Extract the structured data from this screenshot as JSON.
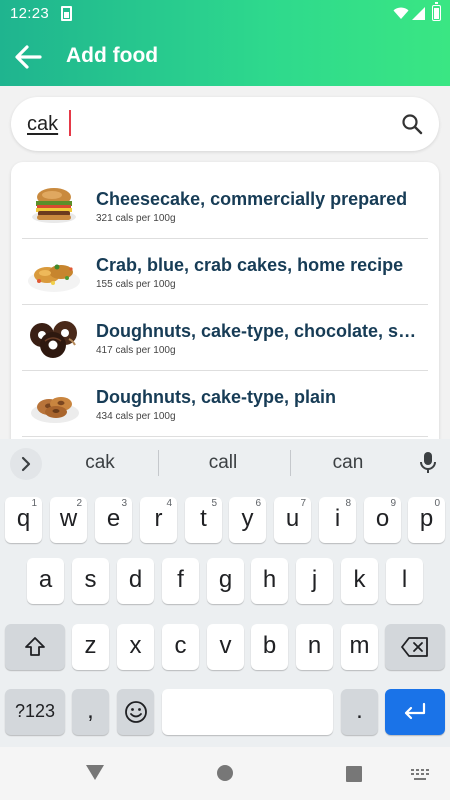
{
  "status_bar": {
    "time": "12:23"
  },
  "app_bar": {
    "title": "Add food"
  },
  "search": {
    "value": "cak"
  },
  "results": [
    {
      "name": "Cheesecake, commercially prepared",
      "cals": "321 cals per 100g",
      "image": "cheesecake"
    },
    {
      "name": "Crab, blue, crab cakes, home recipe",
      "cals": "155 cals per 100g",
      "image": "crab-cakes"
    },
    {
      "name": "Doughnuts, cake-type, chocolate, sugared or glazed",
      "cals": "417 cals per 100g",
      "image": "chocolate-doughnuts"
    },
    {
      "name": "Doughnuts, cake-type, plain",
      "cals": "434 cals per 100g",
      "image": "plain-doughnuts"
    }
  ],
  "keyboard": {
    "suggestions": [
      "cak",
      "call",
      "can"
    ],
    "row1": [
      {
        "k": "q",
        "h": "1"
      },
      {
        "k": "w",
        "h": "2"
      },
      {
        "k": "e",
        "h": "3"
      },
      {
        "k": "r",
        "h": "4"
      },
      {
        "k": "t",
        "h": "5"
      },
      {
        "k": "y",
        "h": "6"
      },
      {
        "k": "u",
        "h": "7"
      },
      {
        "k": "i",
        "h": "8"
      },
      {
        "k": "o",
        "h": "9"
      },
      {
        "k": "p",
        "h": "0"
      }
    ],
    "row2": [
      "a",
      "s",
      "d",
      "f",
      "g",
      "h",
      "j",
      "k",
      "l"
    ],
    "row3": [
      "z",
      "x",
      "c",
      "v",
      "b",
      "n",
      "m"
    ],
    "symbols_label": "?123",
    "comma": ",",
    "period": "."
  },
  "colors": {
    "accent": "#2ed98d",
    "title_text": "#173c56",
    "enter_key": "#1a73e8"
  }
}
